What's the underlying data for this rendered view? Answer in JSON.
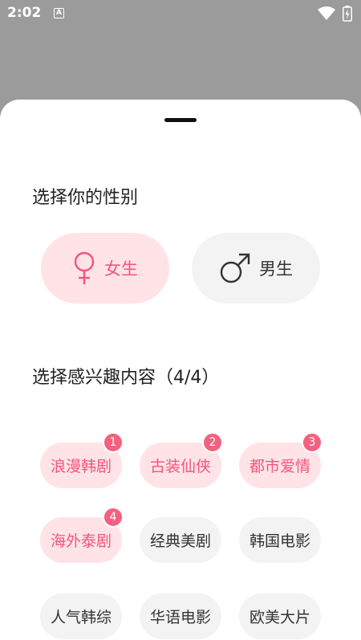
{
  "status_bar": {
    "time": "2:02",
    "notif_letter": "A"
  },
  "gender_section": {
    "title": "选择你的性别",
    "options": [
      {
        "label": "女生",
        "icon": "female-symbol-icon",
        "selected": true
      },
      {
        "label": "男生",
        "icon": "male-symbol-icon",
        "selected": false
      }
    ]
  },
  "interest_section": {
    "title": "选择感兴趣内容（4/4）",
    "tags": [
      {
        "label": "浪漫韩剧",
        "badge": "1",
        "selected": true
      },
      {
        "label": "古装仙侠",
        "badge": "2",
        "selected": true
      },
      {
        "label": "都市爱情",
        "badge": "3",
        "selected": true
      },
      {
        "label": "海外泰剧",
        "badge": "4",
        "selected": true
      },
      {
        "label": "经典美剧",
        "badge": "",
        "selected": false
      },
      {
        "label": "韩国电影",
        "badge": "",
        "selected": false
      },
      {
        "label": "人气韩综",
        "badge": "",
        "selected": false
      },
      {
        "label": "华语电影",
        "badge": "",
        "selected": false
      },
      {
        "label": "欧美大片",
        "badge": "",
        "selected": false
      }
    ]
  },
  "colors": {
    "accent": "#f4557a",
    "selected_bg": "#ffe3e7",
    "normal_bg": "#f3f3f3"
  }
}
